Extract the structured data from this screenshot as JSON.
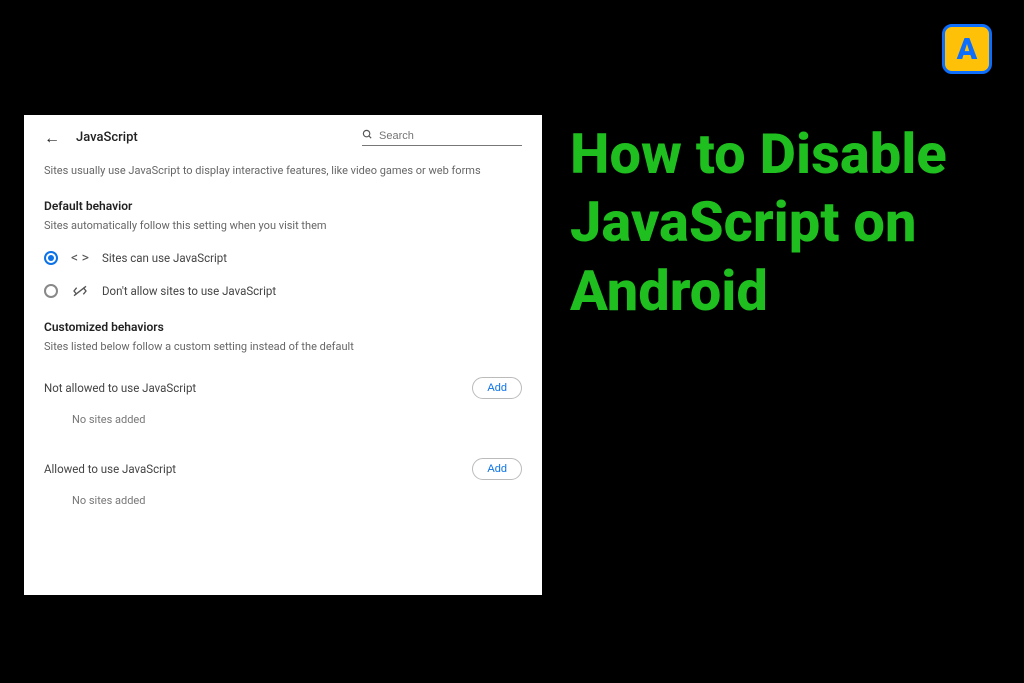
{
  "logo": {
    "letter": "A"
  },
  "headline": "How to Disable JavaScript on Android",
  "panel": {
    "title": "JavaScript",
    "search_placeholder": "Search",
    "intro": "Sites usually use JavaScript to display interactive features, like video games or web forms",
    "default_behavior": {
      "heading": "Default behavior",
      "sub": "Sites automatically follow this setting when you visit them",
      "options": [
        {
          "label": "Sites can use JavaScript",
          "selected": true
        },
        {
          "label": "Don't allow sites to use JavaScript",
          "selected": false
        }
      ]
    },
    "customized": {
      "heading": "Customized behaviors",
      "sub": "Sites listed below follow a custom setting instead of the default",
      "lists": [
        {
          "label": "Not allowed to use JavaScript",
          "add_label": "Add",
          "empty": "No sites added"
        },
        {
          "label": "Allowed to use JavaScript",
          "add_label": "Add",
          "empty": "No sites added"
        }
      ]
    }
  }
}
